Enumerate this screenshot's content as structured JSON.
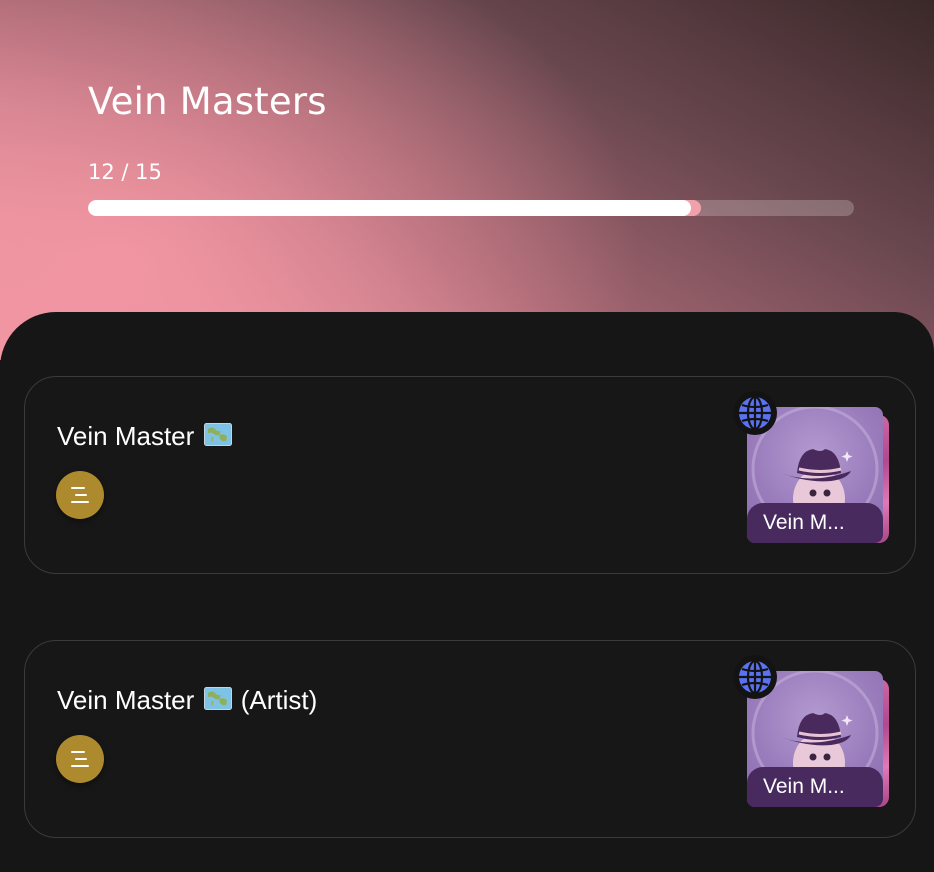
{
  "header": {
    "title": "Vein Masters",
    "progress_text": "12 / 15",
    "progress": 0.8
  },
  "cards": [
    {
      "title": "Vein Master",
      "title_suffix": "",
      "title_icon": "world-map-emoji",
      "menu_icon": "list-menu-icon",
      "badge_label": "Vein M...",
      "badge_icon": "globe-icon"
    },
    {
      "title": "Vein Master",
      "title_suffix": "(Artist)",
      "title_icon": "world-map-emoji",
      "menu_icon": "list-menu-icon",
      "badge_label": "Vein M...",
      "badge_icon": "globe-icon"
    }
  ],
  "colors": {
    "accent_gold": "#ae8a2e",
    "globe_blue": "#5a72f0",
    "badge_purple": "#482a5e",
    "background": "#161616"
  }
}
